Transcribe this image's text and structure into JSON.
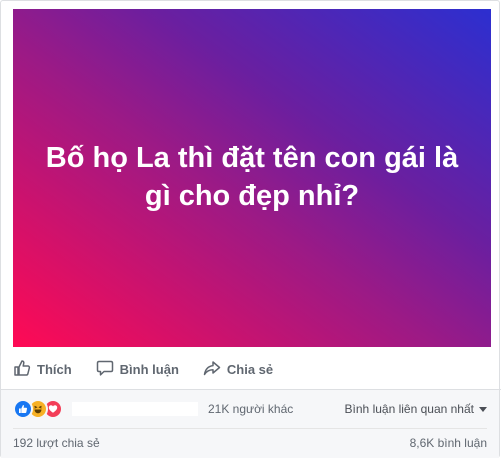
{
  "post": {
    "text": "Bố họ La thì đặt tên con gái là gì cho đẹp nhỉ?",
    "gradient_colors": [
      "#ff0a54",
      "#9b1a86",
      "#6a1fa0",
      "#2c2fd0"
    ]
  },
  "actions": {
    "like": "Thích",
    "comment": "Bình luận",
    "share": "Chia sẻ"
  },
  "reactions": {
    "icons": [
      "like-icon",
      "haha-icon",
      "love-icon"
    ],
    "others_text": "21K người khác",
    "sort_label": "Bình luận liên quan nhất"
  },
  "stats": {
    "shares": "192 lượt chia sẻ",
    "comments": "8,6K bình luận"
  },
  "colors": {
    "link_gray": "#606770",
    "like_blue": "#1877f2",
    "love_red": "#f33e58",
    "haha_yellow": "#f7b125"
  }
}
